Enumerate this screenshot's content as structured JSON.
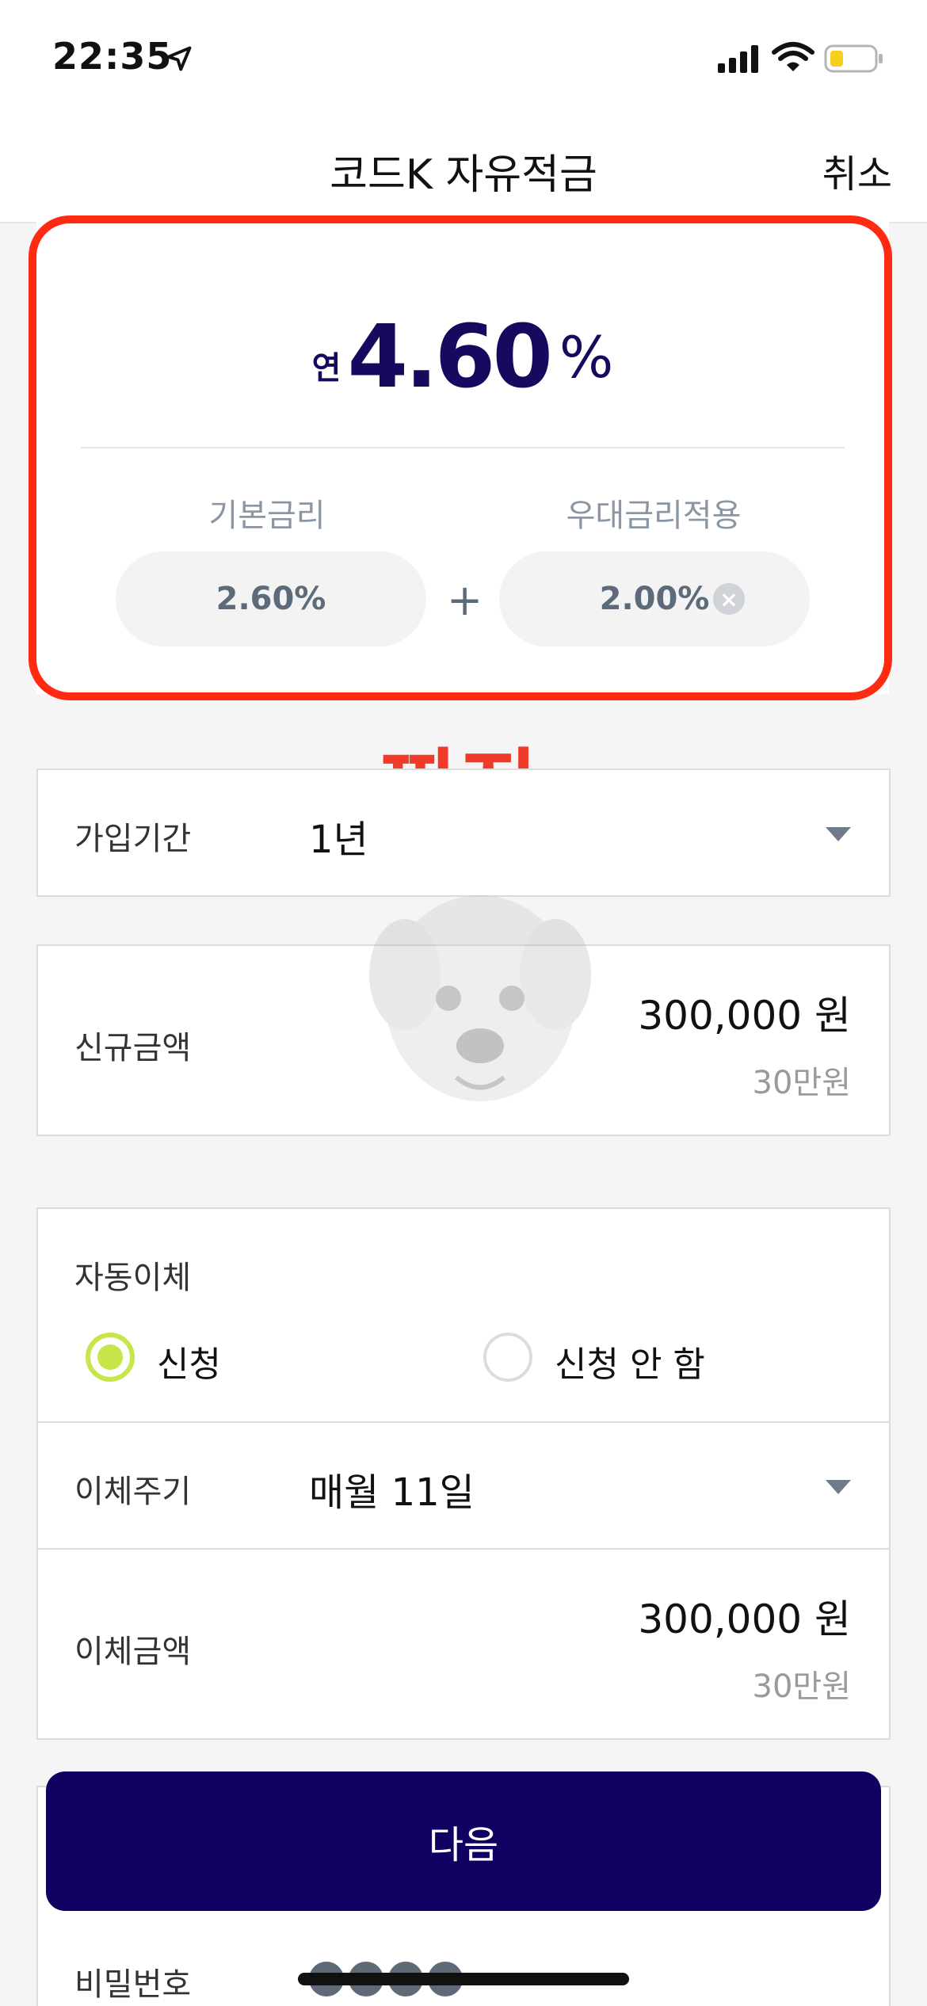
{
  "status_bar": {
    "time": "22:35",
    "icons": [
      "location-arrow-icon",
      "cellular-signal-icon",
      "wifi-icon",
      "battery-low-icon"
    ]
  },
  "header": {
    "title": "코드K 자유적금",
    "cancel_label": "취소"
  },
  "rate_card": {
    "prefix": "연",
    "total_rate": "4.60",
    "unit": "%",
    "base_label": "기본금리",
    "base_value": "2.60%",
    "pref_label": "우대금리적용",
    "pref_value": "2.00%",
    "plus": "+",
    "clear_glyph": "×"
  },
  "annotation": {
    "text": "짜잔",
    "color": "#f03a2a",
    "highlight_color": "#ff2a12"
  },
  "form": {
    "period": {
      "label": "가입기간",
      "value": "1년"
    },
    "new_amount": {
      "label": "신규금액",
      "value": "300,000 원",
      "sub": "30만원"
    },
    "auto_transfer": {
      "label": "자동이체",
      "options": [
        "신청",
        "신청 안 함"
      ],
      "selected": "신청"
    },
    "transfer_cycle": {
      "label": "이체주기",
      "value": "매월 11일"
    },
    "transfer_amount": {
      "label": "이체금액",
      "value": "300,000 원",
      "sub": "30만원"
    },
    "password": {
      "label": "비밀번호",
      "masked_count": 4
    }
  },
  "next_button": {
    "label": "다음"
  },
  "colors": {
    "brand": "#110062",
    "rate_text": "#16095e",
    "radio_accent": "#c6e64a"
  }
}
